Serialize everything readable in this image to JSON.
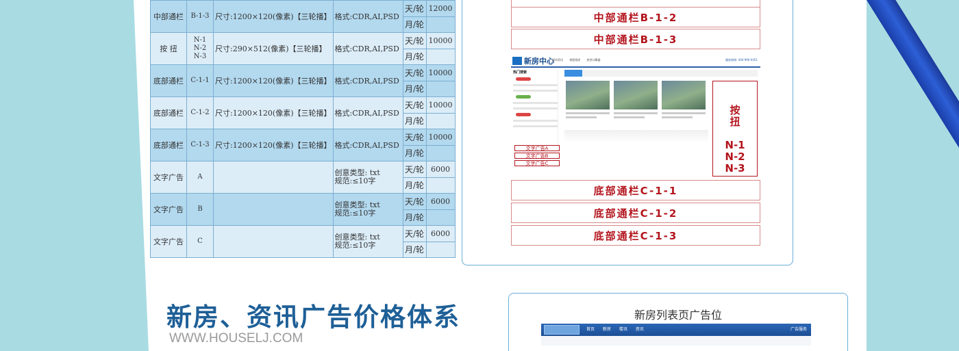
{
  "table": {
    "rows": [
      {
        "name": "中部通栏",
        "code": "B-1-3",
        "size": "尺寸:1200×120(像素)【三轮播】",
        "format": "格式:CDR,AI,PSD",
        "unit1": "天/轮",
        "price": "12000",
        "unit2": "月/轮"
      },
      {
        "name": "按 扭",
        "code": "N-1\nN-2\nN-3",
        "size": "尺寸:290×512(像素)【三轮播】",
        "format": "格式:CDR,AI,PSD",
        "unit1": "天/轮",
        "price": "10000",
        "unit2": "月/轮"
      },
      {
        "name": "底部通栏",
        "code": "C-1-1",
        "size": "尺寸:1200×120(像素)【三轮播】",
        "format": "格式:CDR,AI,PSD",
        "unit1": "天/轮",
        "price": "10000",
        "unit2": "月/轮"
      },
      {
        "name": "底部通栏",
        "code": "C-1-2",
        "size": "尺寸:1200×120(像素)【三轮播】",
        "format": "格式:CDR,AI,PSD",
        "unit1": "天/轮",
        "price": "10000",
        "unit2": "月/轮"
      },
      {
        "name": "底部通栏",
        "code": "C-1-3",
        "size": "尺寸:1200×120(像素)【三轮播】",
        "format": "格式:CDR,AI,PSD",
        "unit1": "天/轮",
        "price": "10000",
        "unit2": "月/轮"
      },
      {
        "name": "文字广告",
        "code": "A",
        "size": "",
        "format": "创意类型: txt\n规范:≤10字",
        "unit1": "天/轮",
        "price": "6000",
        "unit2": "月/轮"
      },
      {
        "name": "文字广告",
        "code": "B",
        "size": "",
        "format": "创意类型: txt\n规范:≤10字",
        "unit1": "天/轮",
        "price": "6000",
        "unit2": "月/轮"
      },
      {
        "name": "文字广告",
        "code": "C",
        "size": "",
        "format": "创意类型: txt\n规范:≤10字",
        "unit1": "天/轮",
        "price": "6000",
        "unit2": "月/轮"
      }
    ]
  },
  "preview": {
    "slots_top": [
      "中部通栏B-1-2",
      "中部通栏B-1-3"
    ],
    "slots_bottom": [
      "底部通栏C-1-1",
      "底部通栏C-1-2",
      "底部通栏C-1-3"
    ],
    "site_logo": "新房中心",
    "site_nav": "楼市资讯 地图找房 房贷计算器",
    "site_hotline": "服务热线: 400-996-0451",
    "side_title": "热门搜索",
    "button_ad": "按\n扭\n\nN-1\nN-2\nN-3",
    "text_ads": [
      "文字广告A",
      "文字广告B",
      "文字广告C"
    ]
  },
  "section": {
    "heading": "新房、资讯广告价格体系",
    "subheading": "WWW.HOUSELJ.COM",
    "panel_title": "新房列表页广告位",
    "panel_nav": "首页 新房 楼讯 资讯",
    "panel_right": "广告服务"
  },
  "colors": {
    "accent_red": "#b3141d",
    "heading_blue": "#1e5f97",
    "table_dark": "#b3d9ef",
    "table_light": "#dcedf8",
    "bg": "#a9dbe2"
  }
}
